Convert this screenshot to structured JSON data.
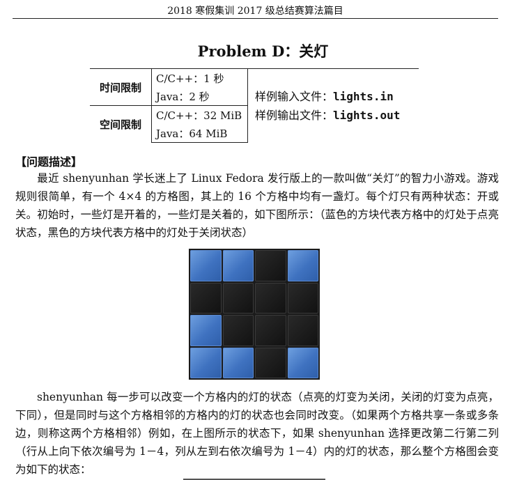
{
  "header": "2018 寒假集训 2017 级总结赛算法篇目",
  "title": "Problem D：关灯",
  "limits": {
    "time_label": "时间限制",
    "time_cpp": "C/C++：1 秒",
    "time_java": "Java：2 秒",
    "space_label": "空间限制",
    "space_cpp": "C/C++：32 MiB",
    "space_java": "Java：64 MiB",
    "input_label": "样例输入文件：",
    "input_file": "lights.in",
    "output_label": "样例输出文件：",
    "output_file": "lights.out"
  },
  "section_title": "【问题描述】",
  "paragraph1": "最近 shenyunhan 学长迷上了 Linux Fedora 发行版上的一款叫做“关灯”的智力小游戏。游戏规则很简单，有一个 4×4 的方格图，其上的 16 个方格中均有一盏灯。每个灯只有两种状态：开或关。初始时，一些灯是开着的，一些灯是关着的，如下图所示：（蓝色的方块代表方格中的灯处于点亮状态，黑色的方块代表方格中的灯处于关闭状态）",
  "paragraph2": "shenyunhan 每一步可以改变一个方格内的灯的状态（点亮的灯变为关闭，关闭的灯变为点亮，下同），但是同时与这个方格相邻的方格内的灯的状态也会同时改变。（如果两个方格共享一条或多条边，则称这两个方格相邻）例如，在上图所示的状态下，如果 shenyunhan 选择更改第二行第二列（行从上向下依次编号为 1－4，列从左到右依次编号为 1－4）内的灯的状态，那么整个方格图会变为如下的状态：",
  "grid": [
    [
      "on",
      "on",
      "off",
      "on"
    ],
    [
      "off",
      "off",
      "off",
      "off"
    ],
    [
      "on",
      "off",
      "off",
      "off"
    ],
    [
      "on",
      "on",
      "off",
      "on"
    ]
  ],
  "colors": {
    "on": "#3f72c0",
    "off": "#111111"
  }
}
